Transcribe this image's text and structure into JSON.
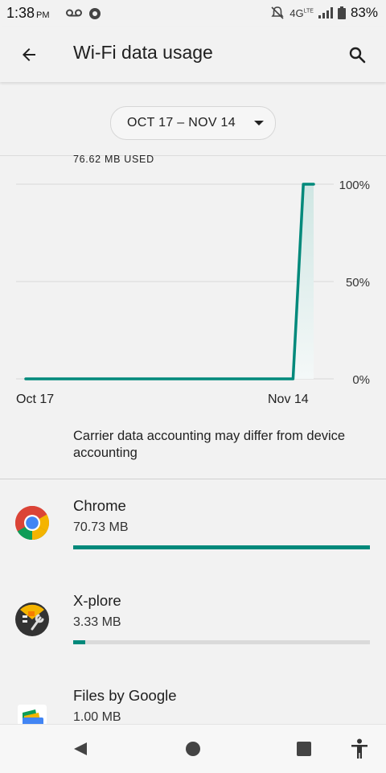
{
  "status_bar": {
    "time": "1:38",
    "ampm": "PM",
    "network": "4G",
    "network_sup": "LTE",
    "battery": "83%"
  },
  "app_bar": {
    "title": "Wi-Fi data usage",
    "back_icon": "arrow-back-icon",
    "search_icon": "search-icon"
  },
  "cycle": {
    "label": "OCT 17 – NOV 14"
  },
  "usage": {
    "total": "76.62 MB USED"
  },
  "chart_data": {
    "type": "line",
    "x_start_label": "Oct 17",
    "x_end_label": "Nov 14",
    "x": [
      "Oct 17",
      "Nov 12",
      "Nov 13",
      "Nov 14"
    ],
    "values": [
      0,
      0,
      100,
      100
    ],
    "y_ticks": [
      "0%",
      "50%",
      "100%"
    ],
    "ylim": [
      0,
      100
    ],
    "color": "#00897b",
    "grid": true
  },
  "note": "Carrier data accounting may differ from device accounting",
  "apps": [
    {
      "name": "Chrome",
      "size": "70.73 MB",
      "fraction": 1.0,
      "icon": "chrome-icon"
    },
    {
      "name": "X-plore",
      "size": "3.33 MB",
      "fraction": 0.04,
      "icon": "xplore-icon"
    },
    {
      "name": "Files by Google",
      "size": "1.00 MB",
      "fraction": 0.014,
      "icon": "files-by-google-icon"
    }
  ],
  "colors": {
    "accent": "#00897b",
    "background": "#f2f2f2"
  }
}
